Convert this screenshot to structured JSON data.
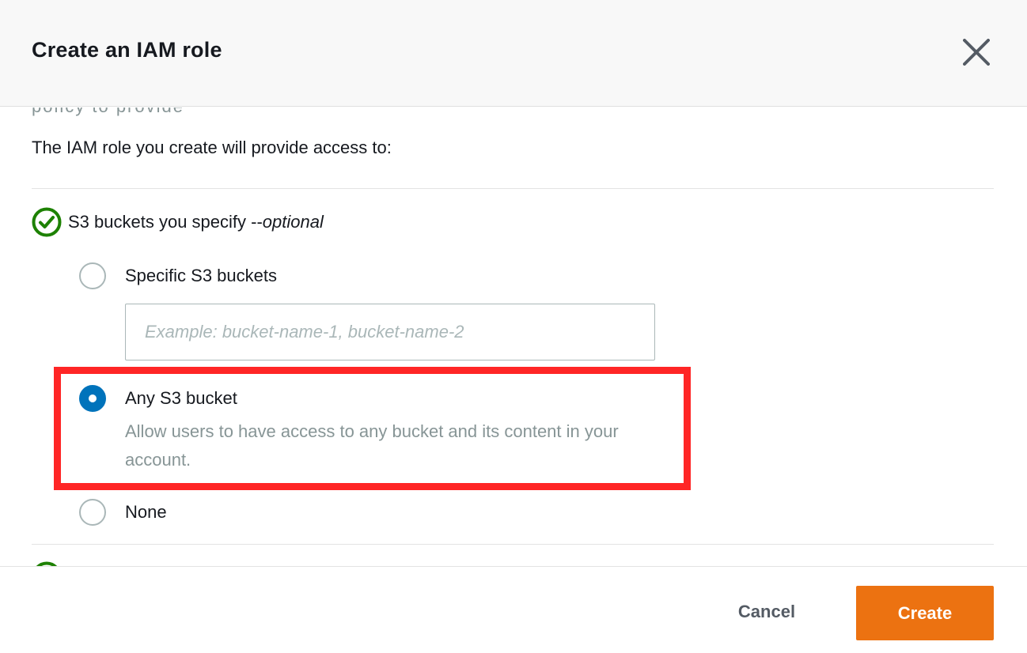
{
  "header": {
    "title": "Create an IAM role",
    "close_icon": "close-icon"
  },
  "body": {
    "cut_off_text": "policy to provide",
    "intro": "The IAM role you create will provide access to:",
    "section": {
      "icon": "check-circle-icon",
      "label": "S3 buckets you specify -- ",
      "optional": "optional"
    },
    "options": [
      {
        "label": "Specific S3 buckets",
        "selected": false
      },
      {
        "label": "Any S3 bucket",
        "selected": true,
        "description": "Allow users to have access to any bucket and its content in your account."
      },
      {
        "label": "None",
        "selected": false
      }
    ],
    "bucket_input": {
      "value": "",
      "placeholder": "Example: bucket-name-1, bucket-name-2"
    },
    "highlight_color": "#ff2626"
  },
  "footer": {
    "cancel_label": "Cancel",
    "create_label": "Create"
  },
  "colors": {
    "primary": "#ec7211",
    "radio_selected": "#0073bb",
    "check_green": "#1d8102",
    "muted_text": "#879596"
  }
}
